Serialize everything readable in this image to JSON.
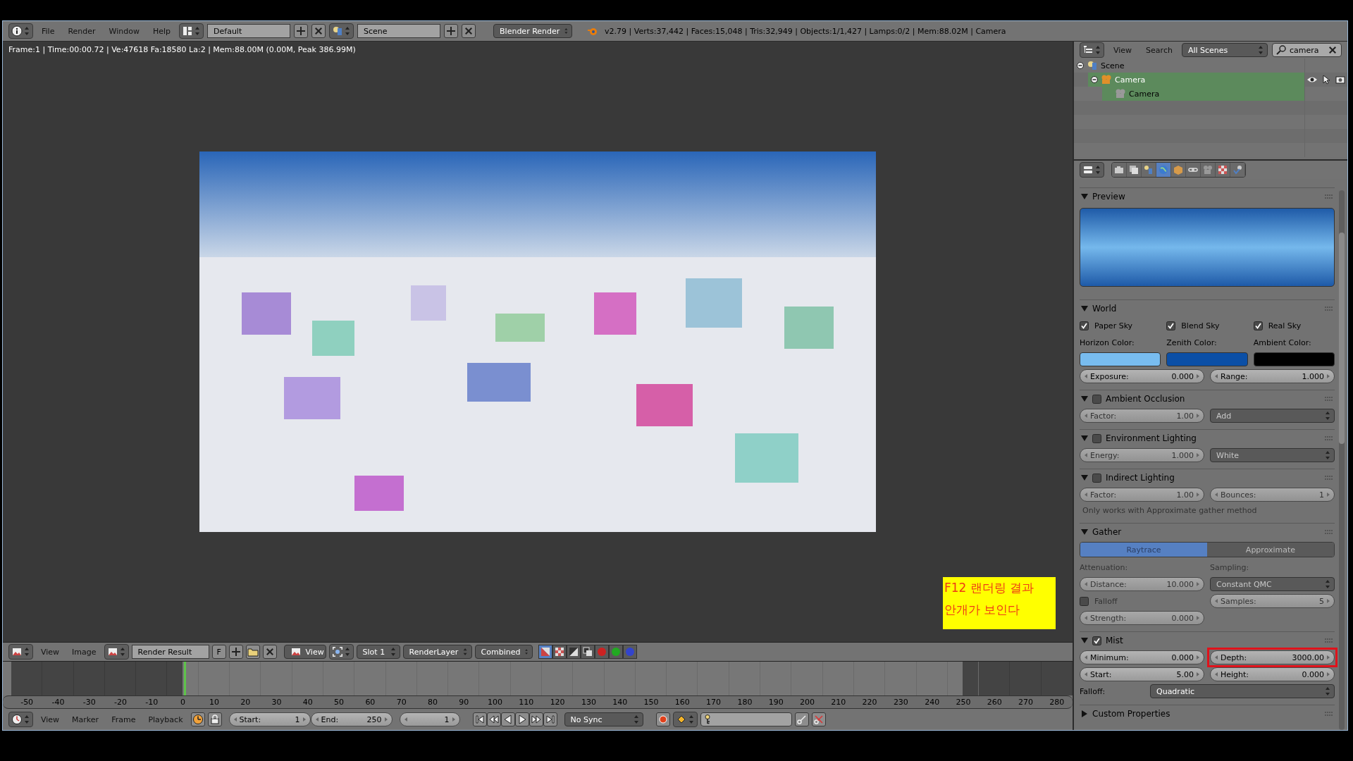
{
  "info_header": {
    "menus": [
      "File",
      "Render",
      "Window",
      "Help"
    ],
    "layout": "Default",
    "scene": "Scene",
    "engine": "Blender Render",
    "stats": "v2.79 | Verts:37,442 | Faces:15,048 | Tris:32,949 | Objects:1/1,427 | Lamps:0/2 | Mem:88.02M | Camera"
  },
  "image_editor": {
    "render_info": "Frame:1 | Time:00:00.72 | Ve:47618 Fa:18580 La:2 | Mem:88.00M (0.00M, Peak 386.99M)",
    "note": [
      "F12 랜더링 결과",
      "안개가 보인다"
    ],
    "menus": [
      "View",
      "Image"
    ],
    "image": "Render Result",
    "fake_user": "F",
    "view": "View",
    "slot": "Slot 1",
    "layer": "RenderLayer",
    "pass": "Combined",
    "display_modes": [
      {
        "kind": "color_alpha",
        "selected": true
      },
      {
        "kind": "alpha",
        "selected": false
      },
      {
        "kind": "z",
        "selected": false
      },
      {
        "kind": "overlay",
        "selected": false
      },
      {
        "kind": "red",
        "selected": false
      },
      {
        "kind": "green",
        "selected": false
      },
      {
        "kind": "blue",
        "selected": false
      }
    ]
  },
  "timeline": {
    "ticks": [
      "-50",
      "-40",
      "-30",
      "-20",
      "-10",
      "0",
      "10",
      "20",
      "30",
      "40",
      "50",
      "60",
      "70",
      "80",
      "90",
      "100",
      "110",
      "120",
      "130",
      "140",
      "150",
      "160",
      "170",
      "180",
      "190",
      "200",
      "210",
      "220",
      "230",
      "240",
      "250",
      "260",
      "270",
      "280"
    ],
    "menus": [
      "View",
      "Marker",
      "Frame",
      "Playback"
    ],
    "start": {
      "label": "Start:",
      "value": "1"
    },
    "end": {
      "label": "End:",
      "value": "250"
    },
    "current": "1",
    "sync": "No Sync"
  },
  "outliner": {
    "menus": [
      "View",
      "Search"
    ],
    "filter": "All Scenes",
    "search": "camera",
    "tree": [
      {
        "label": "Scene",
        "kind": "scene",
        "expanded": true,
        "selected": false,
        "children": [
          {
            "label": "Camera",
            "kind": "object",
            "expanded": true,
            "selected": true,
            "children": [
              {
                "label": "Camera",
                "kind": "camera_data",
                "selected": true
              }
            ]
          }
        ]
      }
    ]
  },
  "properties": {
    "tabs": [
      {
        "kind": "render",
        "selected": false
      },
      {
        "kind": "render_layers",
        "selected": false
      },
      {
        "kind": "scene",
        "selected": false
      },
      {
        "kind": "world",
        "selected": true
      },
      {
        "kind": "object",
        "selected": false
      },
      {
        "kind": "constraints",
        "selected": false
      },
      {
        "kind": "camera_data",
        "selected": false
      },
      {
        "kind": "texture",
        "selected": false
      },
      {
        "kind": "physics",
        "selected": false
      }
    ],
    "panels": [
      {
        "title": "Preview",
        "kind": "preview",
        "expanded": true,
        "dimmed": false
      },
      {
        "title": "World",
        "kind": "rows",
        "expanded": true,
        "dimmed": false,
        "rows": [
          {
            "kind": "grid",
            "items": [
              {
                "kind": "checkbox",
                "label": "Paper Sky",
                "checked": true
              },
              {
                "kind": "checkbox",
                "label": "Blend Sky",
                "checked": true
              },
              {
                "kind": "checkbox",
                "label": "Real Sky",
                "checked": true
              }
            ]
          },
          {
            "kind": "grid",
            "items": [
              {
                "kind": "label",
                "text": "Horizon Color:"
              },
              {
                "kind": "label",
                "text": "Zenith Color:"
              },
              {
                "kind": "label",
                "text": "Ambient Color:"
              }
            ]
          },
          {
            "kind": "grid",
            "items": [
              {
                "kind": "swatch",
                "color": "#78bcef"
              },
              {
                "kind": "swatch",
                "color": "#0b4fa6"
              },
              {
                "kind": "swatch",
                "color": "#000000"
              }
            ]
          },
          {
            "kind": "grid",
            "items": [
              {
                "kind": "number",
                "label": "Exposure:",
                "value": "0.000"
              },
              {
                "kind": "number",
                "label": "Range:",
                "value": "1.000"
              }
            ]
          }
        ]
      },
      {
        "title": "Ambient Occlusion",
        "kind": "rows",
        "expanded": true,
        "enabled": false,
        "dimmed": true,
        "rows": [
          {
            "kind": "grid",
            "items": [
              {
                "kind": "number",
                "label": "Factor:",
                "value": "1.00"
              },
              {
                "kind": "dropdown",
                "value": "Add"
              }
            ]
          }
        ]
      },
      {
        "title": "Environment Lighting",
        "kind": "rows",
        "expanded": true,
        "enabled": false,
        "dimmed": true,
        "rows": [
          {
            "kind": "grid",
            "items": [
              {
                "kind": "number",
                "label": "Energy:",
                "value": "1.000"
              },
              {
                "kind": "dropdown",
                "value": "White"
              }
            ]
          }
        ]
      },
      {
        "title": "Indirect Lighting",
        "kind": "rows",
        "expanded": true,
        "enabled": false,
        "dimmed": true,
        "rows": [
          {
            "kind": "grid",
            "items": [
              {
                "kind": "number",
                "label": "Factor:",
                "value": "1.00"
              },
              {
                "kind": "number",
                "label": "Bounces:",
                "value": "1"
              }
            ]
          },
          {
            "kind": "note",
            "text": "Only works with Approximate gather method"
          }
        ]
      },
      {
        "title": "Gather",
        "kind": "rows",
        "expanded": true,
        "dimmed": true,
        "rows": [
          {
            "kind": "full",
            "items": [
              {
                "kind": "segment",
                "options": [
                  {
                    "label": "Raytrace",
                    "selected": true
                  },
                  {
                    "label": "Approximate",
                    "selected": false
                  }
                ]
              }
            ]
          },
          {
            "kind": "grid",
            "items": [
              {
                "kind": "label",
                "text": "Attenuation:"
              },
              {
                "kind": "label",
                "text": "Sampling:"
              }
            ]
          },
          {
            "kind": "grid",
            "items": [
              {
                "kind": "number",
                "label": "Distance:",
                "value": "10.000"
              },
              {
                "kind": "dropdown",
                "value": "Constant QMC"
              }
            ]
          },
          {
            "kind": "grid",
            "items": [
              {
                "kind": "checkbox",
                "label": "Falloff",
                "checked": false
              },
              {
                "kind": "number",
                "label": "Samples:",
                "value": "5"
              }
            ]
          },
          {
            "kind": "grid",
            "items": [
              {
                "kind": "number",
                "label": "Strength:",
                "value": "0.000"
              }
            ]
          }
        ]
      },
      {
        "title": "Mist",
        "kind": "rows",
        "expanded": true,
        "enabled": true,
        "dimmed": false,
        "rows": [
          {
            "kind": "grid",
            "items": [
              {
                "kind": "number",
                "label": "Minimum:",
                "value": "0.000"
              },
              {
                "kind": "number",
                "label": "Depth:",
                "value": "3000.00",
                "highlighted": true
              }
            ]
          },
          {
            "kind": "grid",
            "items": [
              {
                "kind": "number",
                "label": "Start:",
                "value": "5.00"
              },
              {
                "kind": "number",
                "label": "Height:",
                "value": "0.000"
              }
            ]
          },
          {
            "kind": "inline",
            "items": [
              {
                "kind": "label",
                "text": "Falloff:"
              },
              {
                "kind": "dropdown",
                "value": "Quadratic"
              }
            ]
          }
        ]
      },
      {
        "title": "Custom Properties",
        "kind": "rows",
        "expanded": false
      }
    ]
  }
}
